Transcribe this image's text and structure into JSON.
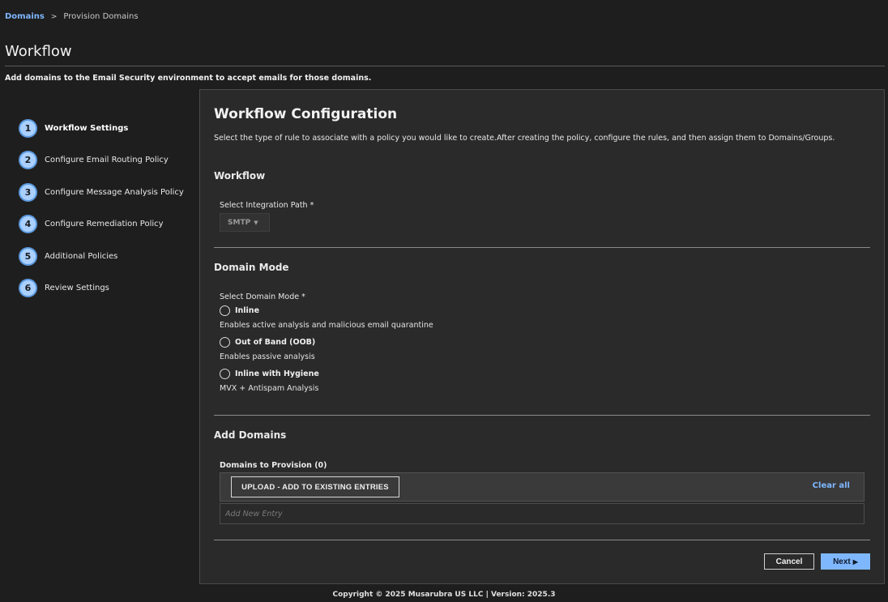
{
  "breadcrumb": {
    "root": "Domains",
    "separator": ">",
    "current": "Provision Domains"
  },
  "page": {
    "title": "Workflow",
    "description": "Add domains to the Email Security environment to accept emails for those domains."
  },
  "steps": [
    {
      "number": "1",
      "label": "Workflow Settings"
    },
    {
      "number": "2",
      "label": "Configure Email Routing Policy"
    },
    {
      "number": "3",
      "label": "Configure Message Analysis Policy"
    },
    {
      "number": "4",
      "label": "Configure Remediation Policy"
    },
    {
      "number": "5",
      "label": "Additional Policies"
    },
    {
      "number": "6",
      "label": "Review Settings"
    }
  ],
  "panel": {
    "title": "Workflow Configuration",
    "description": "Select the type of rule to associate with a policy you would like to create.After creating the policy, configure the rules, and then assign them to Domains/Groups."
  },
  "workflow": {
    "section_title": "Workflow",
    "integration_label": "Select Integration Path *",
    "integration_value": "SMTP"
  },
  "domain_mode": {
    "section_title": "Domain Mode",
    "label": "Select Domain Mode *",
    "options": [
      {
        "label": "Inline",
        "description": "Enables active analysis and malicious email quarantine"
      },
      {
        "label": "Out of Band (OOB)",
        "description": "Enables passive analysis"
      },
      {
        "label": "Inline with Hygiene",
        "description": "MVX + Antispam Analysis"
      }
    ]
  },
  "add_domains": {
    "section_title": "Add Domains",
    "provision_label": "Domains to Provision (0)",
    "upload_label": "UPLOAD - ADD TO EXISTING ENTRIES",
    "clear_label": "Clear all",
    "entry_placeholder": "Add New Entry"
  },
  "actions": {
    "cancel": "Cancel",
    "next": "Next"
  },
  "footer": "Copyright © 2025 Musarubra US LLC | Version: 2025.3",
  "colors": {
    "accent": "#7fb7ff",
    "background": "#1e1e1e",
    "panel": "#2a2a2a"
  }
}
